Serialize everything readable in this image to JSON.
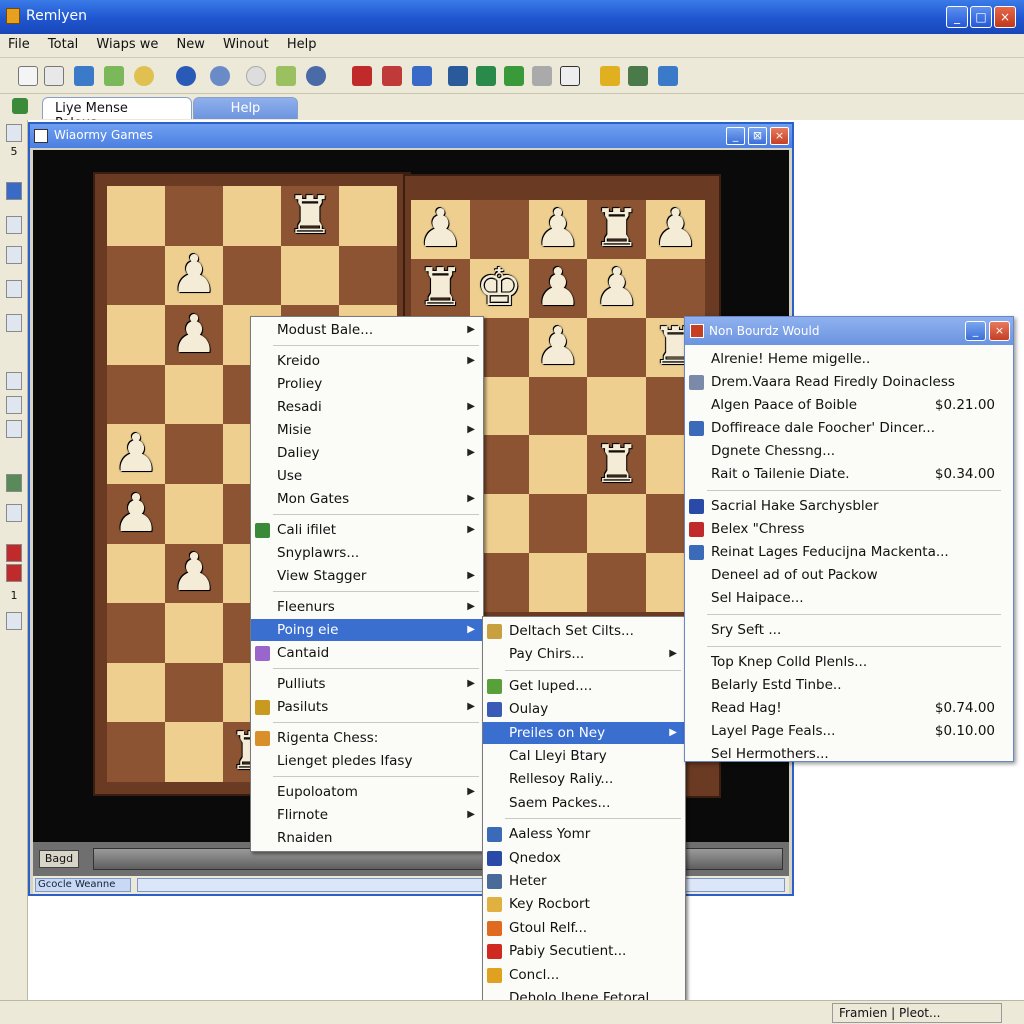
{
  "app": {
    "title": "Remlyen"
  },
  "window_controls": {
    "min": "_",
    "max": "□",
    "close": "×"
  },
  "menubar": [
    "File",
    "Total",
    "Wiaps we",
    "New",
    "Winout",
    "Help"
  ],
  "tabs": {
    "active": "Liye Mense Paleus...",
    "inactive": "Help"
  },
  "leftstrip": {
    "a": "5",
    "b": "1"
  },
  "game_window": {
    "title": "Wiaormy Games",
    "bottom_button": "Bagd",
    "status": "Gcocle Weanne"
  },
  "board_left": {
    "cols": 5,
    "rows": 10,
    "light_first": true,
    "pieces": [
      {
        "r": 0,
        "c": 3,
        "p": "♜"
      },
      {
        "r": 1,
        "c": 1,
        "p": "♟"
      },
      {
        "r": 2,
        "c": 1,
        "p": "♟"
      },
      {
        "r": 4,
        "c": 0,
        "p": "♟"
      },
      {
        "r": 5,
        "c": 0,
        "p": "♟"
      },
      {
        "r": 6,
        "c": 1,
        "p": "♟"
      },
      {
        "r": 9,
        "c": 2,
        "p": "♜"
      }
    ]
  },
  "board_right": {
    "cols": 5,
    "rows": 7,
    "light_first": true,
    "pieces": [
      {
        "r": 0,
        "c": 0,
        "p": "♟"
      },
      {
        "r": 0,
        "c": 2,
        "p": "♟"
      },
      {
        "r": 0,
        "c": 3,
        "p": "♜"
      },
      {
        "r": 0,
        "c": 4,
        "p": "♟"
      },
      {
        "r": 1,
        "c": 0,
        "p": "♜"
      },
      {
        "r": 1,
        "c": 1,
        "p": "♚"
      },
      {
        "r": 1,
        "c": 2,
        "p": "♟"
      },
      {
        "r": 1,
        "c": 3,
        "p": "♟"
      },
      {
        "r": 2,
        "c": 2,
        "p": "♟"
      },
      {
        "r": 2,
        "c": 4,
        "p": "♜"
      },
      {
        "r": 4,
        "c": 3,
        "p": "♜"
      }
    ]
  },
  "menu1": {
    "items": [
      {
        "label": "Modust Bale...",
        "sub": true
      },
      {
        "sep": true
      },
      {
        "label": "Kreido",
        "sub": true
      },
      {
        "label": "Proliey",
        "sub": false
      },
      {
        "label": "Resadi",
        "sub": true
      },
      {
        "label": "Misie",
        "sub": true
      },
      {
        "label": "Daliey",
        "sub": true
      },
      {
        "label": "Use",
        "sub": false
      },
      {
        "label": "Mon Gates",
        "sub": true
      },
      {
        "sep": true
      },
      {
        "label": "Cali ifilet",
        "sub": true,
        "icon": "image-icon",
        "color": "#3a8a3a"
      },
      {
        "label": "Snyplawrs...",
        "sub": false
      },
      {
        "label": "View Stagger",
        "sub": true
      },
      {
        "sep": true
      },
      {
        "label": "Fleenurs",
        "sub": true
      },
      {
        "label": "Poing eie",
        "sub": true,
        "highlight": true
      },
      {
        "label": "Cantaid",
        "sub": false,
        "icon": "paint-icon",
        "color": "#9a66cc"
      },
      {
        "sep": true
      },
      {
        "label": "Pulliuts",
        "sub": true
      },
      {
        "label": "Pasiluts",
        "sub": true,
        "icon": "trophy-icon",
        "color": "#c89a20"
      },
      {
        "sep": true
      },
      {
        "label": "Rigenta Chess:",
        "sub": false,
        "icon": "hand-icon",
        "color": "#d9902a"
      },
      {
        "label": "Lienget pledes Ifasy",
        "sub": false
      },
      {
        "sep": true
      },
      {
        "label": "Eupoloatom",
        "sub": true
      },
      {
        "label": "Flirnote",
        "sub": true
      },
      {
        "label": "Rnaiden",
        "sub": false
      }
    ]
  },
  "menu2": {
    "items": [
      {
        "label": "Deltach Set Cilts...",
        "sub": false,
        "icon": "pieces-icon",
        "color": "#c8a040"
      },
      {
        "label": "Pay Chirs...",
        "sub": true
      },
      {
        "sep": true
      },
      {
        "label": "Get luped....",
        "sub": false,
        "icon": "globe-icon",
        "color": "#5aa03a"
      },
      {
        "label": "Oulay",
        "sub": false,
        "icon": "bottle-icon",
        "color": "#3a5ab8"
      },
      {
        "label": "Preiles on Ney",
        "sub": true,
        "highlight": true
      },
      {
        "label": "Cal Lleyi Btary",
        "sub": false
      },
      {
        "label": "Rellesoy Raliy...",
        "sub": false
      },
      {
        "label": "Saem Packes...",
        "sub": false
      },
      {
        "sep": true
      },
      {
        "label": "Aaless Yomr",
        "sub": false,
        "icon": "grid-icon",
        "color": "#3a6ab8"
      },
      {
        "label": "Qnedox",
        "sub": false,
        "icon": "apps-icon",
        "color": "#2a4aa8"
      },
      {
        "label": "Heter",
        "sub": false,
        "icon": "tool-icon",
        "color": "#4a6a9a"
      },
      {
        "label": "Key Rocbort",
        "sub": false,
        "icon": "folder-icon",
        "color": "#e0b040"
      },
      {
        "label": "Gtoul Relf...",
        "sub": false,
        "icon": "shield-icon",
        "color": "#e06a20"
      },
      {
        "label": "Pabiy Secutient...",
        "sub": false,
        "icon": "circle-icon",
        "color": "#d02a20"
      },
      {
        "label": "Concl...",
        "sub": false,
        "icon": "cup-icon",
        "color": "#e0a020"
      },
      {
        "label": "Deholo Jhene Fetoral",
        "sub": false
      }
    ]
  },
  "nb_window": {
    "title": "Non Bourdz Would",
    "items": [
      {
        "label": "Alrenie! Heme migelle..",
        "price": ""
      },
      {
        "label": "Drem.Vaara Read Firedly Doinacless",
        "price": "",
        "icon": "page-icon",
        "color": "#7a8aa8"
      },
      {
        "label": "Algen Paace of Boible",
        "price": "$0.21.00"
      },
      {
        "label": "Doffireace dale Foocher' Dincer...",
        "price": "",
        "icon": "tool-icon",
        "color": "#3a6ab8"
      },
      {
        "label": "Dgnete Chessng...",
        "price": ""
      },
      {
        "label": "Rait o Tailenie Diate.",
        "price": "$0.34.00"
      },
      {
        "sep": true
      },
      {
        "label": "Sacrial Hake Sarchysbler",
        "price": "",
        "icon": "grid-icon",
        "color": "#2a4aa8"
      },
      {
        "label": "Belex \"Chress",
        "price": "",
        "icon": "book-icon",
        "color": "#c02a2a"
      },
      {
        "label": "Reinat Lages Feducijna Mackenta...",
        "price": "",
        "icon": "tool-icon",
        "color": "#3a6ab8"
      },
      {
        "label": "Deneel ad of out Packow",
        "price": ""
      },
      {
        "label": "Sel Haipace...",
        "price": ""
      },
      {
        "sep": true
      },
      {
        "label": "Sry Seft ...",
        "price": ""
      },
      {
        "sep": true
      },
      {
        "label": "Top Knep Colld Plenls...",
        "price": ""
      },
      {
        "label": "Belarly Estd Tinbe..",
        "price": ""
      },
      {
        "label": "Read Hag!",
        "price": "$0.74.00"
      },
      {
        "label": "Layel Page Feals...",
        "price": "$0.10.00"
      },
      {
        "label": "Sel Hermothers...",
        "price": ""
      }
    ]
  },
  "statusbar": {
    "text": "Framien | Pleot..."
  }
}
